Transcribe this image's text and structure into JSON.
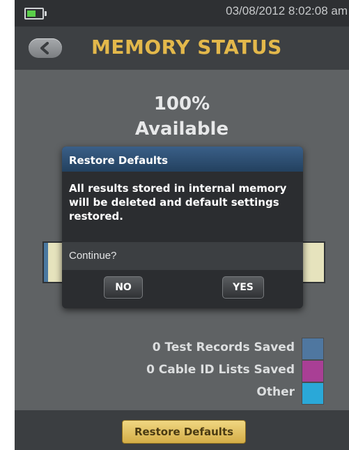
{
  "status_bar": {
    "battery_level": 0.6,
    "datetime": "03/08/2012 8:02:08 am"
  },
  "header": {
    "back_icon": "chevron-left-icon",
    "title": "MEMORY STATUS"
  },
  "memory": {
    "percent": "100%",
    "available_label": "Available",
    "legend": [
      {
        "label": "0 Test Records Saved",
        "color": "#4f77a0"
      },
      {
        "label": "0 Cable ID Lists Saved",
        "color": "#a93f95"
      },
      {
        "label": "Other",
        "color": "#2aa8d8"
      }
    ]
  },
  "dialog": {
    "title": "Restore Defaults",
    "message": "All results stored in internal memory will be deleted and default settings restored.",
    "question": "Continue?",
    "no_label": "NO",
    "yes_label": "YES"
  },
  "footer": {
    "restore_button_label": "Restore Defaults"
  }
}
